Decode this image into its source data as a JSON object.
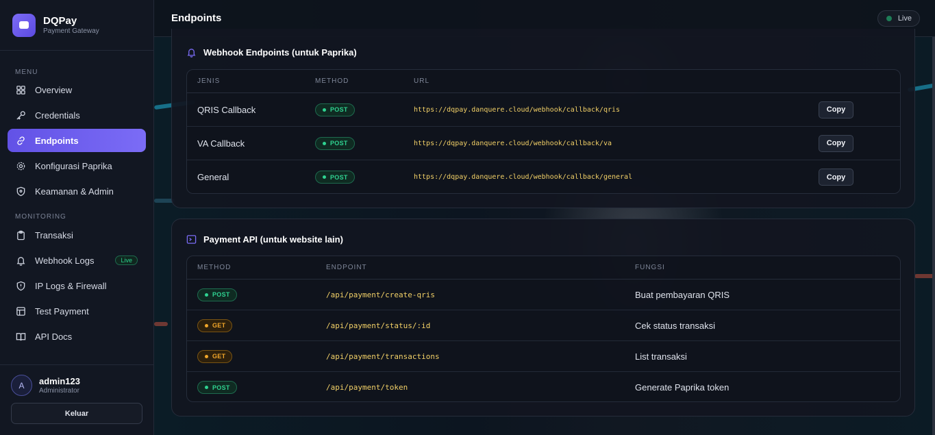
{
  "brand": {
    "name": "DQPay",
    "subtitle": "Payment Gateway"
  },
  "sidebar": {
    "menu_label": "MENU",
    "menu_items": [
      {
        "label": "Overview",
        "icon": "grid-icon"
      },
      {
        "label": "Credentials",
        "icon": "key-icon"
      },
      {
        "label": "Endpoints",
        "icon": "link-icon",
        "active": true
      },
      {
        "label": "Konfigurasi Paprika",
        "icon": "gear-icon"
      },
      {
        "label": "Keamanan & Admin",
        "icon": "shield-icon"
      }
    ],
    "monitoring_label": "MONITORING",
    "monitoring_items": [
      {
        "label": "Transaksi",
        "icon": "clipboard-icon"
      },
      {
        "label": "Webhook Logs",
        "icon": "bell-icon",
        "badge": "Live"
      },
      {
        "label": "IP Logs & Firewall",
        "icon": "shield-alert-icon"
      },
      {
        "label": "Test Payment",
        "icon": "layout-icon"
      },
      {
        "label": "API Docs",
        "icon": "book-icon"
      }
    ],
    "user": {
      "initial": "A",
      "name": "admin123",
      "role": "Administrator"
    },
    "logout_label": "Keluar"
  },
  "header": {
    "title": "Endpoints",
    "status": "Live"
  },
  "webhook": {
    "title": "Webhook Endpoints (untuk Paprika)",
    "columns": [
      "JENIS",
      "METHOD",
      "URL"
    ],
    "rows": [
      {
        "jenis": "QRIS Callback",
        "method": "POST",
        "url": "https://dqpay.danquere.cloud/webhook/callback/qris",
        "copy": "Copy"
      },
      {
        "jenis": "VA Callback",
        "method": "POST",
        "url": "https://dqpay.danquere.cloud/webhook/callback/va",
        "copy": "Copy"
      },
      {
        "jenis": "General",
        "method": "POST",
        "url": "https://dqpay.danquere.cloud/webhook/callback/general",
        "copy": "Copy"
      }
    ]
  },
  "api": {
    "title": "Payment API (untuk website lain)",
    "columns": [
      "METHOD",
      "ENDPOINT",
      "FUNGSI"
    ],
    "rows": [
      {
        "method": "POST",
        "endpoint": "/api/payment/create-qris",
        "fungsi": "Buat pembayaran QRIS"
      },
      {
        "method": "GET",
        "endpoint": "/api/payment/status/:id",
        "fungsi": "Cek status transaksi"
      },
      {
        "method": "GET",
        "endpoint": "/api/payment/transactions",
        "fungsi": "List transaksi"
      },
      {
        "method": "POST",
        "endpoint": "/api/payment/token",
        "fungsi": "Generate Paprika token"
      }
    ]
  },
  "colors": {
    "accent": "#6b5cf0",
    "post": "#2fd391",
    "get": "#f1a62a",
    "url": "#f2d067"
  }
}
